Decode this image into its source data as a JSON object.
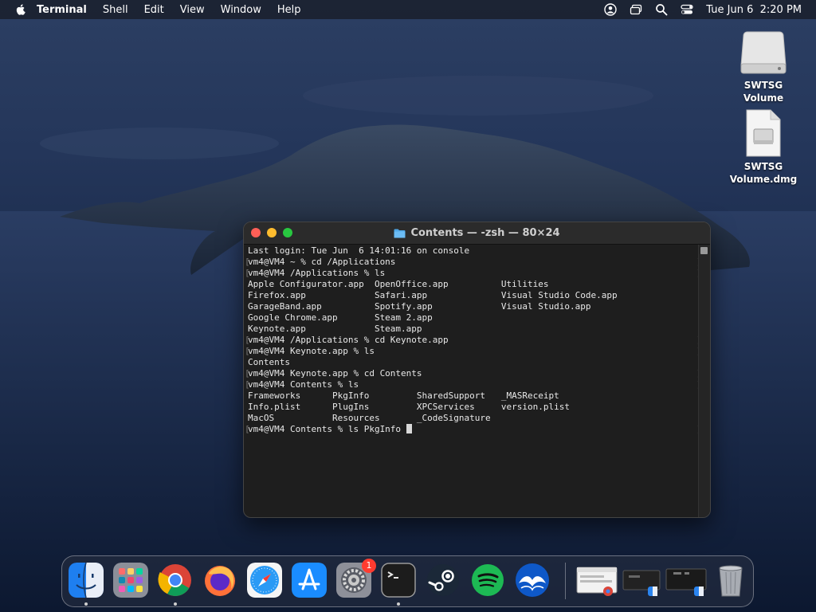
{
  "menubar": {
    "app_name": "Terminal",
    "items": [
      "Shell",
      "Edit",
      "View",
      "Window",
      "Help"
    ],
    "clock": "Tue Jun 6  2:20 PM"
  },
  "desktop": {
    "icons": [
      {
        "label": "SWTSG Volume",
        "kind": "disk-icon"
      },
      {
        "label_line1": "SWTSG",
        "label_line2": "Volume.dmg",
        "kind": "dmg-file-icon"
      }
    ]
  },
  "terminal": {
    "title": "Contents — -zsh — 80×24",
    "lines": [
      "Last login: Tue Jun  6 14:01:16 on console",
      "vm4@VM4 ~ % cd /Applications",
      "vm4@VM4 /Applications % ls",
      "Apple Configurator.app  OpenOffice.app          Utilities",
      "Firefox.app             Safari.app              Visual Studio Code.app",
      "GarageBand.app          Spotify.app             Visual Studio.app",
      "Google Chrome.app       Steam 2.app",
      "Keynote.app             Steam.app",
      "vm4@VM4 /Applications % cd Keynote.app",
      "vm4@VM4 Keynote.app % ls",
      "Contents",
      "vm4@VM4 Keynote.app % cd Contents",
      "vm4@VM4 Contents % ls",
      "Frameworks      PkgInfo         SharedSupport   _MASReceipt",
      "Info.plist      PlugIns         XPCServices     version.plist",
      "MacOS           Resources       _CodeSignature",
      "vm4@VM4 Contents % ls PkgInfo "
    ]
  },
  "dock": {
    "apps": [
      {
        "name": "finder-icon",
        "running": true
      },
      {
        "name": "launchpad-icon",
        "running": false
      },
      {
        "name": "chrome-icon",
        "running": true
      },
      {
        "name": "firefox-icon",
        "running": false
      },
      {
        "name": "safari-icon",
        "running": false
      },
      {
        "name": "app-store-icon",
        "running": false
      },
      {
        "name": "system-settings-icon",
        "running": false,
        "badge": "1"
      },
      {
        "name": "terminal-icon",
        "running": true
      },
      {
        "name": "steam-icon",
        "running": false
      },
      {
        "name": "spotify-icon",
        "running": false
      },
      {
        "name": "openoffice-icon",
        "running": false
      }
    ],
    "colors": {
      "steam": "#1b2838",
      "spotify": "#1db954",
      "appstore": "#1a8cff",
      "chrome_red": "#db4437"
    }
  }
}
